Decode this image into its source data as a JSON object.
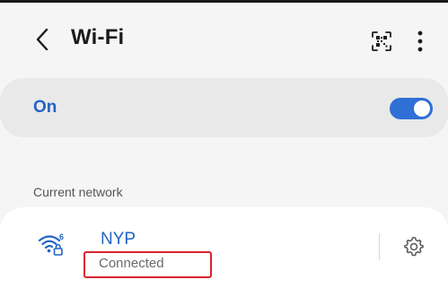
{
  "header": {
    "title": "Wi-Fi",
    "back_icon": "chevron-left-icon",
    "qr_icon": "qr-scan-icon",
    "more_icon": "more-vertical-icon"
  },
  "wifi_toggle": {
    "label": "On",
    "state": true,
    "accent_color": "#2f6fd6"
  },
  "current_network": {
    "section_label": "Current network",
    "name": "NYP",
    "status": "Connected",
    "signal_icon": "wifi-secured-icon",
    "wifi_standard": "6",
    "settings_icon": "gear-icon",
    "highlight_color": "#d9232e"
  }
}
